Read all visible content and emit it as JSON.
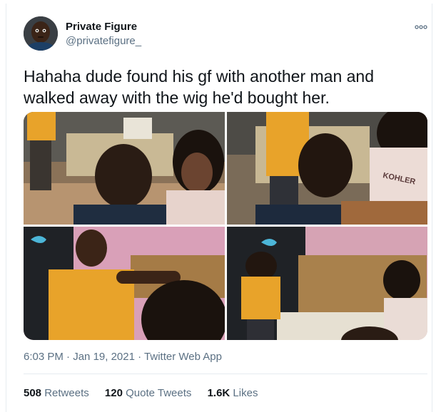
{
  "tweet": {
    "author_name": "Private Figure",
    "author_handle": "@privatefigure_",
    "text": "Hahaha dude found his gf with another man and walked away with the wig he'd bought her.",
    "media_text": "KOHLER",
    "time": "6:03 PM",
    "separator": "·",
    "date": "Jan 19, 2021",
    "source": "Twitter Web App",
    "stats": {
      "retweets_count": "508",
      "retweets_label": "Retweets",
      "quotes_count": "120",
      "quotes_label": "Quote Tweets",
      "likes_count": "1.6K",
      "likes_label": "Likes"
    }
  },
  "icons": {
    "more": "more-icon",
    "avatar": "avatar"
  },
  "colors": {
    "text_primary": "#0f1419",
    "text_secondary": "#5b7083",
    "divider": "#e6ecf0",
    "media_shirt_yellow": "#e8a32a",
    "media_wall_pink": "#d9a0b8"
  }
}
